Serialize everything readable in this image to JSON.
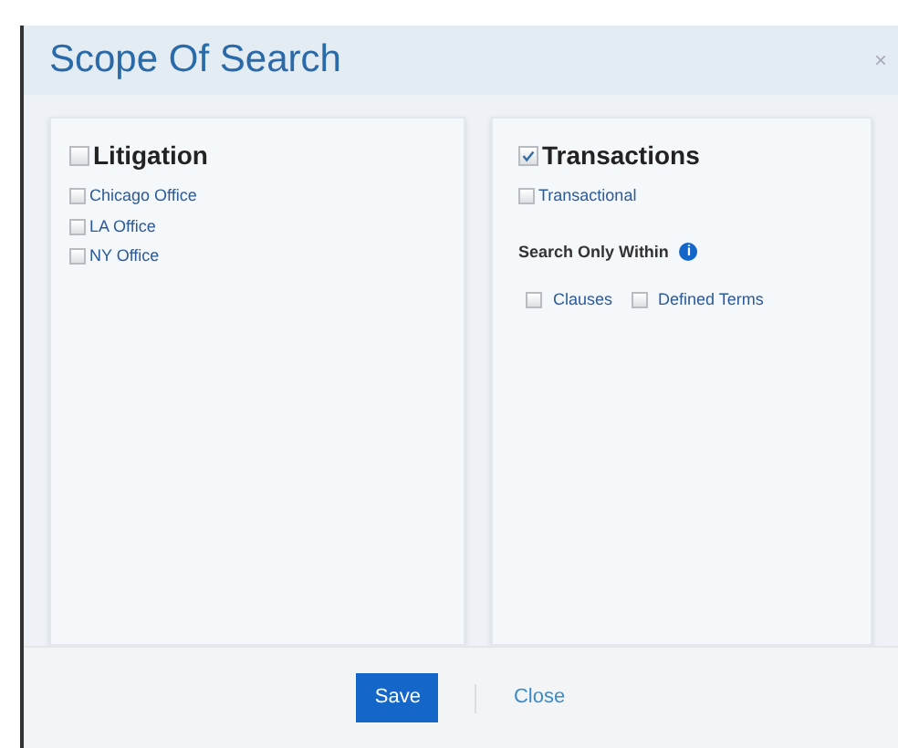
{
  "dialog": {
    "title": "Scope Of Search",
    "close": "×"
  },
  "panels": [
    {
      "heading": {
        "label": "Litigation",
        "checked": false
      },
      "options": [
        {
          "label": "Chicago Office",
          "checked": false
        },
        {
          "label": "LA Office",
          "checked": false
        },
        {
          "label": "NY Office",
          "checked": false
        }
      ]
    },
    {
      "heading": {
        "label": "Transactions",
        "checked": true
      },
      "options": [
        {
          "label": "Transactional",
          "checked": false
        }
      ],
      "within": {
        "label": "Search Only Within",
        "info": "i",
        "options": [
          {
            "label": "Clauses",
            "checked": false
          },
          {
            "label": "Defined Terms",
            "checked": false
          }
        ]
      }
    }
  ],
  "buttons": {
    "save": "Save",
    "close": "Close"
  }
}
